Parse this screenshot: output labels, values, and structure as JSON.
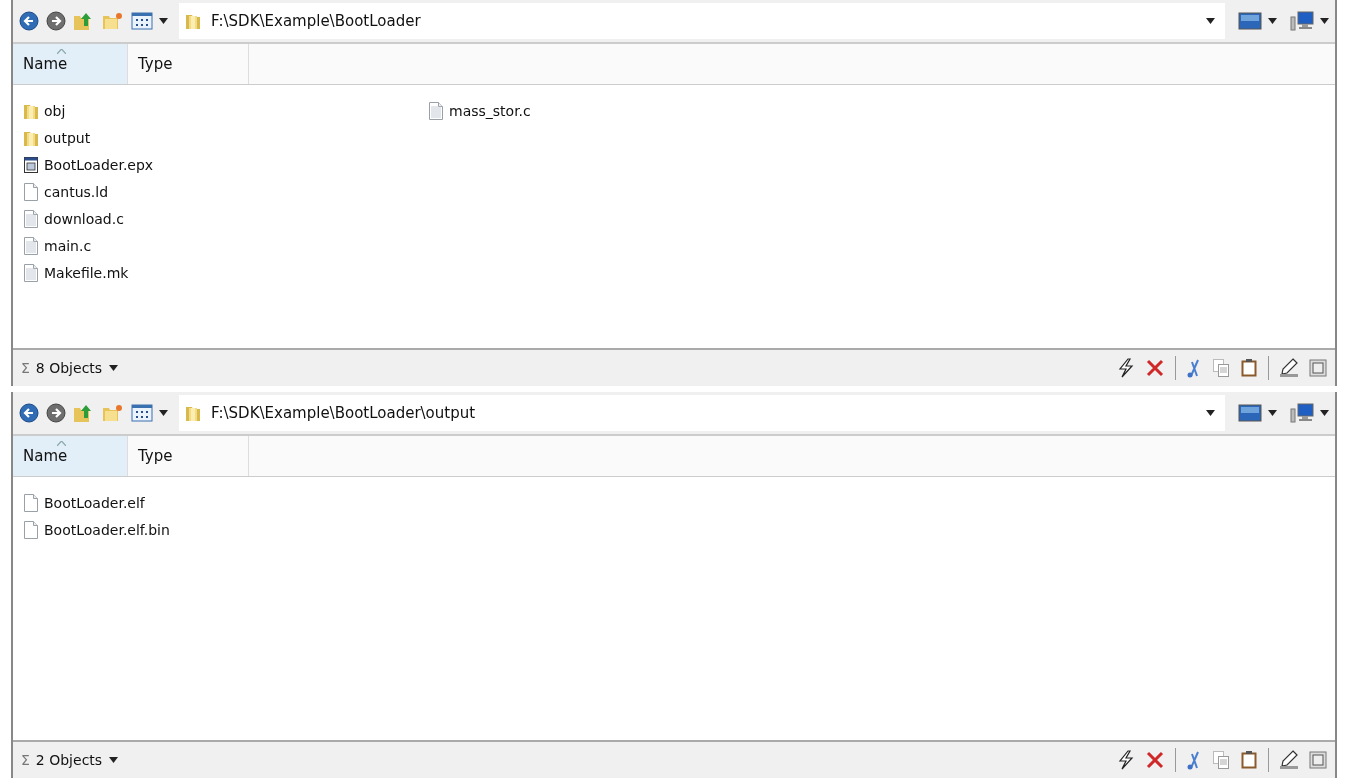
{
  "panes": [
    {
      "path": "F:\\SDK\\Example\\BootLoader",
      "columns": [
        {
          "label": "Name",
          "sorted": true
        },
        {
          "label": "Type",
          "sorted": false
        }
      ],
      "files": [
        {
          "name": "obj",
          "kind": "folder"
        },
        {
          "name": "output",
          "kind": "folder"
        },
        {
          "name": "BootLoader.epx",
          "kind": "app"
        },
        {
          "name": "cantus.ld",
          "kind": "file"
        },
        {
          "name": "download.c",
          "kind": "text"
        },
        {
          "name": "main.c",
          "kind": "text"
        },
        {
          "name": "Makefile.mk",
          "kind": "text"
        },
        {
          "name": "mass_stor.c",
          "kind": "text"
        }
      ],
      "status": {
        "sigma": "Σ",
        "count": "8 Objects"
      }
    },
    {
      "path": "F:\\SDK\\Example\\BootLoader\\output",
      "columns": [
        {
          "label": "Name",
          "sorted": true
        },
        {
          "label": "Type",
          "sorted": false
        }
      ],
      "files": [
        {
          "name": "BootLoader.elf",
          "kind": "file"
        },
        {
          "name": "BootLoader.elf.bin",
          "kind": "file"
        }
      ],
      "status": {
        "sigma": "Σ",
        "count": "2 Objects"
      }
    }
  ]
}
